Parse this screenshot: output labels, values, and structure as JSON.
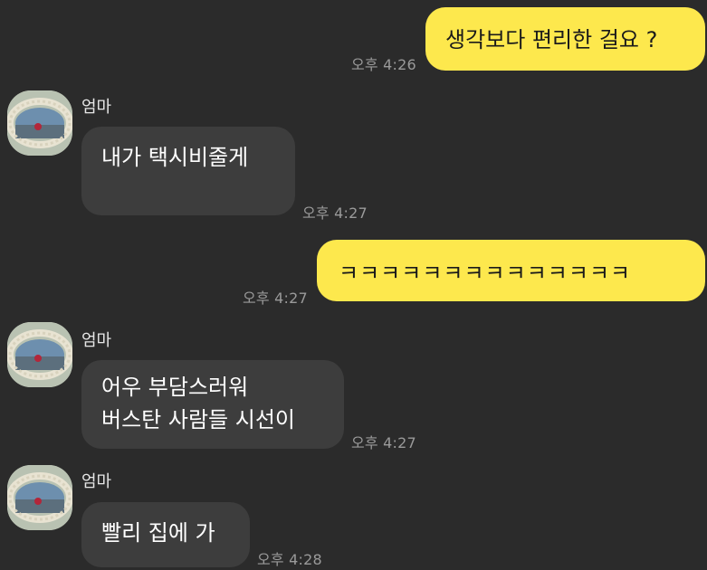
{
  "messages": [
    {
      "type": "outgoing",
      "text": "생각보다 편리한 걸요 ?",
      "time": "오후 4:26"
    },
    {
      "type": "incoming",
      "sender": "엄마",
      "text": "내가 택시비줄게",
      "time": "오후 4:27"
    },
    {
      "type": "outgoing",
      "text": "ㅋㅋㅋㅋㅋㅋㅋㅋㅋㅋㅋㅋㅋㅋ",
      "time": "오후 4:27"
    },
    {
      "type": "incoming",
      "sender": "엄마",
      "lines": [
        "어우 부담스러워",
        "버스탄 사람들 시선이"
      ],
      "time": "오후 4:27"
    },
    {
      "type": "incoming",
      "sender": "엄마",
      "text": "빨리 집에 가",
      "time": "오후 4:28"
    }
  ],
  "colors": {
    "background": "#2b2b2b",
    "outgoing_bubble": "#fde84d",
    "incoming_bubble": "#3d3d3d",
    "time_text": "#9a9a9a"
  },
  "icons": {
    "avatar": "profile-photo-avatar"
  }
}
